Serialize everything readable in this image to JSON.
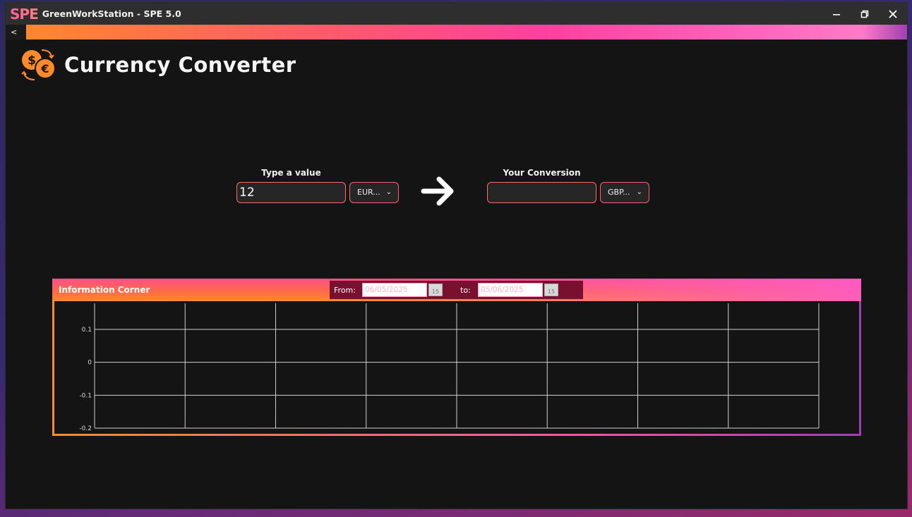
{
  "window": {
    "logo": "SPE",
    "title": "GreenWorkStation - SPE 5.0",
    "minimize": "−",
    "restore": "⧉",
    "close": "✕",
    "back_label": "<"
  },
  "header": {
    "title": "Currency Converter",
    "icon": "currency-exchange-icon"
  },
  "converter": {
    "input_label": "Type a value",
    "input_value": "12",
    "from_currency": "EUR...",
    "output_label": "Your Conversion",
    "output_value": "",
    "to_currency": "GBP...",
    "arrow": "➜"
  },
  "info_corner": {
    "title": "Information Corner",
    "from_label": "From:",
    "from_date": "06/05/2025",
    "to_label": "to:",
    "to_date": "05/06/2025",
    "calendar_glyph": "15"
  },
  "colors": {
    "accent_orange": "#ff8a2a",
    "accent_pink": "#ff4fa0",
    "background": "#141414"
  },
  "chart_data": {
    "type": "line",
    "series": [],
    "y_ticks": [
      "0.1",
      "0",
      "-0.1",
      "-0.2"
    ],
    "ylim": [
      -0.2,
      0.1
    ],
    "grid": true,
    "x_gridlines": 9
  }
}
